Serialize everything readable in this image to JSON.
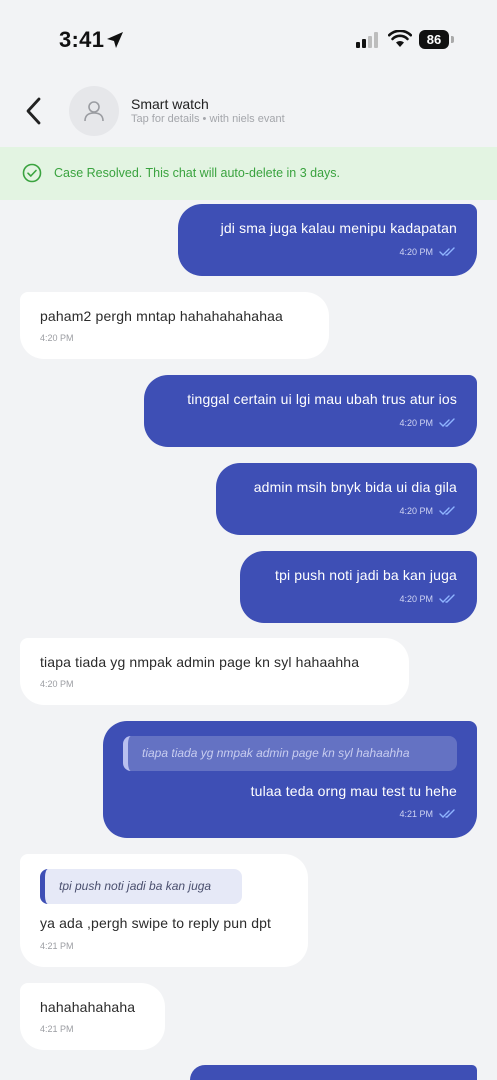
{
  "status_bar": {
    "time": "3:41",
    "battery": "86"
  },
  "header": {
    "title": "Smart watch",
    "subtitle": "Tap for details • with niels evant"
  },
  "banner": {
    "text": "Case Resolved. This chat will auto-delete in 3 days."
  },
  "messages": [
    {
      "direction": "outgoing",
      "text": "jdi sma juga kalau menipu kadapatan",
      "time": "4:20 PM",
      "read": true
    },
    {
      "direction": "incoming",
      "text": "paham2 pergh mntap hahahahahahaa",
      "time": "4:20 PM"
    },
    {
      "direction": "outgoing",
      "text": "tinggal certain ui lgi mau ubah trus atur ios",
      "time": "4:20 PM",
      "read": true
    },
    {
      "direction": "outgoing",
      "text": "admin msih bnyk bida ui dia gila",
      "time": "4:20 PM",
      "read": true
    },
    {
      "direction": "outgoing",
      "text": "tpi push noti jadi ba kan juga",
      "time": "4:20 PM",
      "read": true
    },
    {
      "direction": "incoming",
      "text": "tiapa tiada yg nmpak admin page kn syl hahaahha",
      "time": "4:20 PM"
    },
    {
      "direction": "outgoing",
      "quote": "tiapa tiada yg nmpak admin page kn syl hahaahha",
      "text": "tulaa teda orng mau test tu hehe",
      "time": "4:21 PM",
      "read": true
    },
    {
      "direction": "incoming",
      "quote": "tpi push noti jadi ba kan juga",
      "text": "ya ada ,pergh swipe to reply pun dpt",
      "time": "4:21 PM"
    },
    {
      "direction": "incoming",
      "text": "hahahahahaha",
      "time": "4:21 PM"
    }
  ],
  "colors": {
    "outgoing_bubble": "#3e4fb5",
    "incoming_bubble": "#ffffff",
    "banner_bg": "#e3f4e2",
    "banner_text": "#3aa33f",
    "read_ticks": "#8fb4ff"
  }
}
